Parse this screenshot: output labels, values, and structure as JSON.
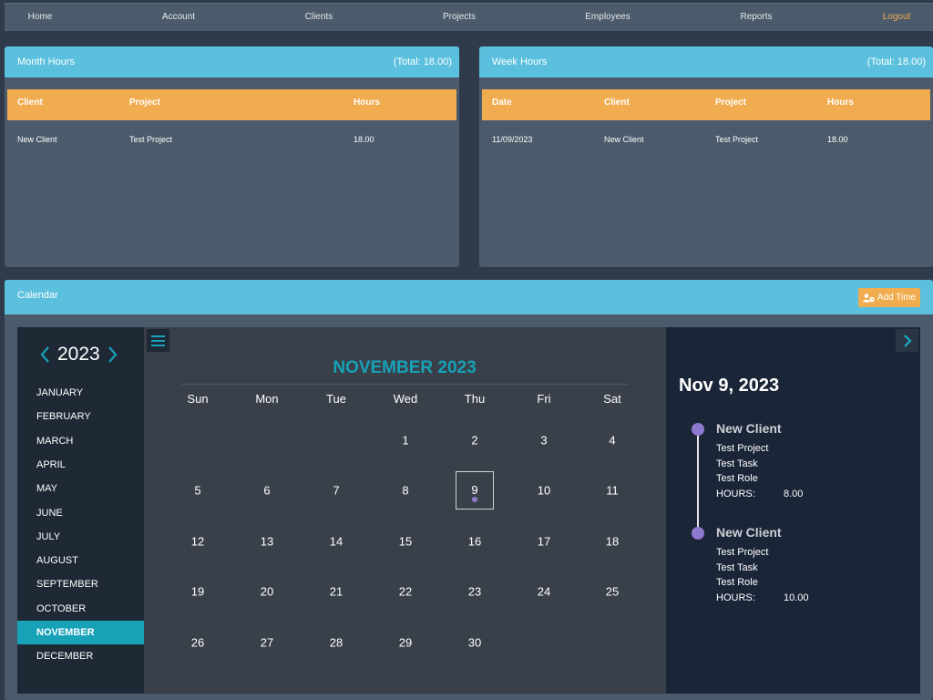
{
  "nav": {
    "items": [
      "Home",
      "Account",
      "Clients",
      "Projects",
      "Employees",
      "Reports"
    ],
    "logout": "Logout"
  },
  "month_hours": {
    "title": "Month Hours",
    "total": "(Total: 18.00)",
    "columns": [
      "Client",
      "Project",
      "Hours"
    ],
    "rows": [
      [
        "New Client",
        "Test Project",
        "18.00"
      ]
    ]
  },
  "week_hours": {
    "title": "Week Hours",
    "total": "(Total: 18.00)",
    "columns": [
      "Date",
      "Client",
      "Project",
      "Hours"
    ],
    "rows": [
      [
        "11/09/2023",
        "New Client",
        "Test Project",
        "18.00"
      ]
    ]
  },
  "calendar": {
    "title": "Calendar",
    "add_time": "Add Time",
    "year": "2023",
    "months": [
      "JANUARY",
      "FEBRUARY",
      "MARCH",
      "APRIL",
      "MAY",
      "JUNE",
      "JULY",
      "AUGUST",
      "SEPTEMBER",
      "OCTOBER",
      "NOVEMBER",
      "DECEMBER"
    ],
    "active_month_index": 10,
    "month_title": "NOVEMBER 2023",
    "weekdays": [
      "Sun",
      "Mon",
      "Tue",
      "Wed",
      "Thu",
      "Fri",
      "Sat"
    ],
    "first_weekday": 3,
    "days_in_month": 30,
    "selected_day": 9,
    "event_days": [
      9
    ],
    "selected_date_label": "Nov 9, 2023",
    "events": [
      {
        "client": "New Client",
        "project": "Test Project",
        "task": "Test Task",
        "role": "Test Role",
        "hours_label": "HOURS:",
        "hours": "8.00"
      },
      {
        "client": "New Client",
        "project": "Test Project",
        "task": "Test Task",
        "role": "Test Role",
        "hours_label": "HOURS:",
        "hours": "10.00"
      }
    ]
  },
  "colors": {
    "accent_blue": "#5bc0de",
    "accent_orange": "#f0ac4f",
    "accent_teal": "#17a2b8",
    "event_purple": "#8e79cf"
  },
  "icons": {
    "prev_year": "chevron-left-icon",
    "next_year": "chevron-right-icon",
    "menu": "hamburger-icon",
    "next_panel": "chevron-right-icon",
    "add_time": "user-clock-icon"
  }
}
